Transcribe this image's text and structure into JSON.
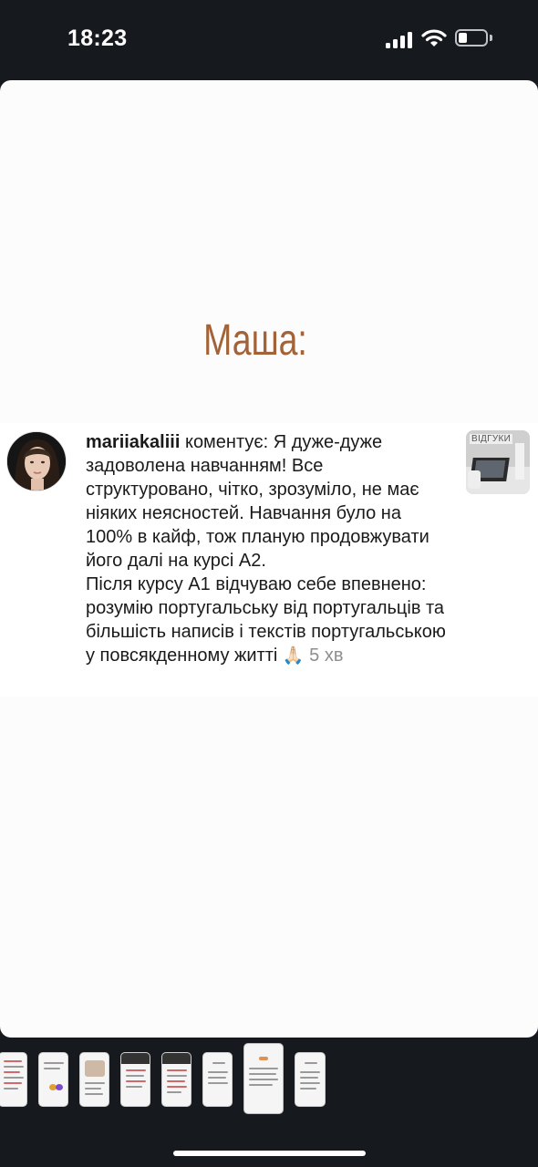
{
  "status_bar": {
    "time": "18:23"
  },
  "story": {
    "title": "Маша:"
  },
  "comment": {
    "username": "mariiakaliii",
    "action": " коментує: ",
    "text": "Я дуже-дуже задоволена навчанням! Все структуровано, чітко, зрозуміло, не має ніяких неясностей. Навчання було на 100% в кайф, тож планую продовжувати його далі на курсі А2.\nПісля курсу А1 відчуваю себе впевнено: розумію португальську від португальців та більшість написів і текстів португальською у повсякденному житті ",
    "emoji": "🙏🏻",
    "time_ago": " 5 хв",
    "thumbnail_label": "ВІДГУКИ"
  },
  "thumbnails": {
    "count": 8,
    "selected_index": 6
  },
  "colors": {
    "title": "#a16337",
    "background": "#16191e",
    "card": "#fcfcfc"
  }
}
